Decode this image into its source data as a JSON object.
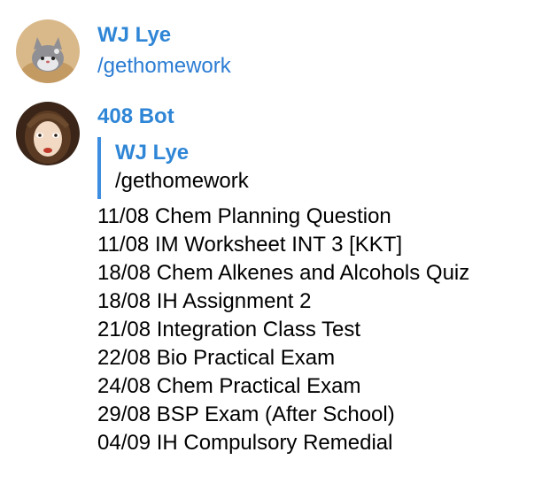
{
  "colors": {
    "link_blue": "#2b7cd3",
    "sender_blue": "#2f86d6",
    "quote_bar": "#3d8de0"
  },
  "messages": [
    {
      "sender": "WJ Lye",
      "avatar_icon": "cat-plush-avatar-icon",
      "text": "/gethomework"
    },
    {
      "sender": "408 Bot",
      "avatar_icon": "doll-face-avatar-icon",
      "reply": {
        "sender": "WJ Lye",
        "text": "/gethomework"
      },
      "homework": [
        "11/08 Chem Planning Question",
        "11/08 IM Worksheet INT 3 [KKT]",
        "18/08 Chem Alkenes and Alcohols Quiz",
        "18/08 IH Assignment 2",
        "21/08 Integration Class Test",
        "22/08 Bio Practical Exam",
        "24/08 Chem Practical Exam",
        "29/08 BSP Exam (After School)",
        "04/09 IH Compulsory Remedial"
      ]
    }
  ]
}
